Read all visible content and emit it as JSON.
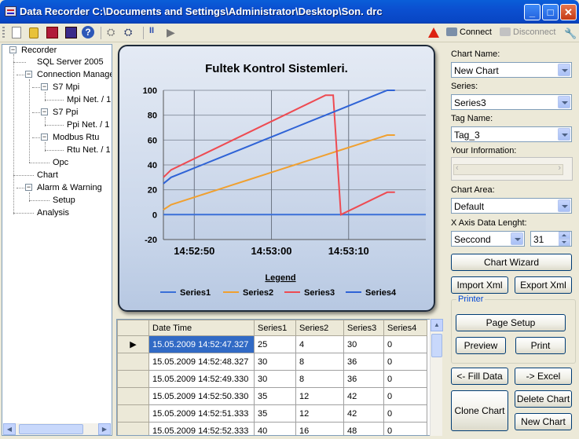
{
  "window": {
    "title": "Data Recorder C:\\Documents and Settings\\Administrator\\Desktop\\Son. drc",
    "min_glyph": "_",
    "max_glyph": "□",
    "close_glyph": "✕"
  },
  "toolbar": {
    "connect_label": "Connect",
    "disconnect_label": "Disconnect",
    "help_glyph": "?",
    "pause_glyph": "II",
    "play_glyph": "▶",
    "tool_glyph": "🔧"
  },
  "tree": {
    "items": [
      {
        "label": "Recorder"
      },
      {
        "label": "SQL Server 2005"
      },
      {
        "label": "Connection Manage"
      },
      {
        "label": "S7 Mpi"
      },
      {
        "label": "Mpi Net. / 1"
      },
      {
        "label": "S7 Ppi"
      },
      {
        "label": "Ppi Net. / 1"
      },
      {
        "label": "Modbus Rtu"
      },
      {
        "label": "Rtu Net. / 1"
      },
      {
        "label": "Opc"
      },
      {
        "label": "Chart"
      },
      {
        "label": "Alarm & Warning"
      },
      {
        "label": "Setup"
      },
      {
        "label": "Analysis"
      }
    ]
  },
  "chart_data": {
    "type": "line",
    "title": "Fultek Kontrol Sistemleri.",
    "legend_title": "Legend",
    "legend_position": "bottom",
    "xlabel": "",
    "ylabel": "",
    "ylim": [
      -20,
      100
    ],
    "yticks": [
      -20,
      0,
      20,
      40,
      60,
      80,
      100
    ],
    "xticks": [
      "14:52:50",
      "14:53:00",
      "14:53:10"
    ],
    "x_seconds_range": [
      46,
      80
    ],
    "x_tick_seconds": [
      50,
      60,
      70
    ],
    "grid": true,
    "series": [
      {
        "name": "Series1",
        "color": "#3a6fd8",
        "values": [
          [
            46,
            0
          ],
          [
            80,
            0
          ]
        ]
      },
      {
        "name": "Series2",
        "color": "#f0a030",
        "values": [
          [
            46,
            4
          ],
          [
            47,
            8
          ],
          [
            49,
            12
          ],
          [
            51,
            16
          ],
          [
            53,
            20
          ],
          [
            55,
            24
          ],
          [
            57,
            28
          ],
          [
            59,
            32
          ],
          [
            61,
            36
          ],
          [
            63,
            40
          ],
          [
            65,
            44
          ],
          [
            67,
            48
          ],
          [
            69,
            52
          ],
          [
            71,
            56
          ],
          [
            73,
            60
          ],
          [
            75,
            64
          ],
          [
            76,
            64
          ]
        ]
      },
      {
        "name": "Series3",
        "color": "#ee4b52",
        "values": [
          [
            46,
            30
          ],
          [
            47,
            36
          ],
          [
            49,
            42
          ],
          [
            51,
            48
          ],
          [
            53,
            54
          ],
          [
            55,
            60
          ],
          [
            57,
            66
          ],
          [
            59,
            72
          ],
          [
            61,
            78
          ],
          [
            63,
            84
          ],
          [
            65,
            90
          ],
          [
            67,
            96
          ],
          [
            68,
            96
          ],
          [
            69,
            0
          ],
          [
            71,
            6
          ],
          [
            73,
            12
          ],
          [
            75,
            18
          ],
          [
            76,
            18
          ]
        ]
      },
      {
        "name": "Series4",
        "color": "#2f63d6",
        "values": [
          [
            46,
            25
          ],
          [
            47,
            30
          ],
          [
            49,
            35
          ],
          [
            51,
            40
          ],
          [
            53,
            45
          ],
          [
            55,
            50
          ],
          [
            57,
            55
          ],
          [
            59,
            60
          ],
          [
            61,
            65
          ],
          [
            63,
            70
          ],
          [
            65,
            75
          ],
          [
            67,
            80
          ],
          [
            69,
            85
          ],
          [
            71,
            90
          ],
          [
            73,
            95
          ],
          [
            75,
            100
          ],
          [
            76,
            100
          ]
        ]
      }
    ]
  },
  "grid": {
    "columns": [
      "Date Time",
      "Series1",
      "Series2",
      "Series3",
      "Series4"
    ],
    "rows": [
      [
        "15.05.2009 14:52:47.327",
        "25",
        "4",
        "30",
        "0"
      ],
      [
        "15.05.2009 14:52:48.327",
        "30",
        "8",
        "36",
        "0"
      ],
      [
        "15.05.2009 14:52:49.330",
        "30",
        "8",
        "36",
        "0"
      ],
      [
        "15.05.2009 14:52:50.330",
        "35",
        "12",
        "42",
        "0"
      ],
      [
        "15.05.2009 14:52:51.333",
        "35",
        "12",
        "42",
        "0"
      ],
      [
        "15.05.2009 14:52:52.333",
        "40",
        "16",
        "48",
        "0"
      ]
    ],
    "selected_row_marker": "▶"
  },
  "panel": {
    "chart_name_label": "Chart Name:",
    "chart_name_value": "New Chart",
    "series_label": "Series:",
    "series_value": "Series3",
    "tag_name_label": "Tag Name:",
    "tag_name_value": "Tag_3",
    "info_label": "Your Information:",
    "chart_area_label": "Chart Area:",
    "chart_area_value": "Default",
    "x_axis_label": "X Axis Data Lenght:",
    "x_axis_unit": "Seccond",
    "x_axis_length": "31",
    "chart_wizard": "Chart Wizard",
    "import_xml": "Import Xml",
    "export_xml": "Export Xml",
    "printer_group": "Printer",
    "page_setup": "Page Setup",
    "preview": "Preview",
    "print": "Print",
    "fill_data": "<- Fill Data",
    "excel": "-> Excel",
    "clone_chart": "Clone Chart",
    "delete_chart": "Delete Chart",
    "new_chart": "New Chart"
  }
}
